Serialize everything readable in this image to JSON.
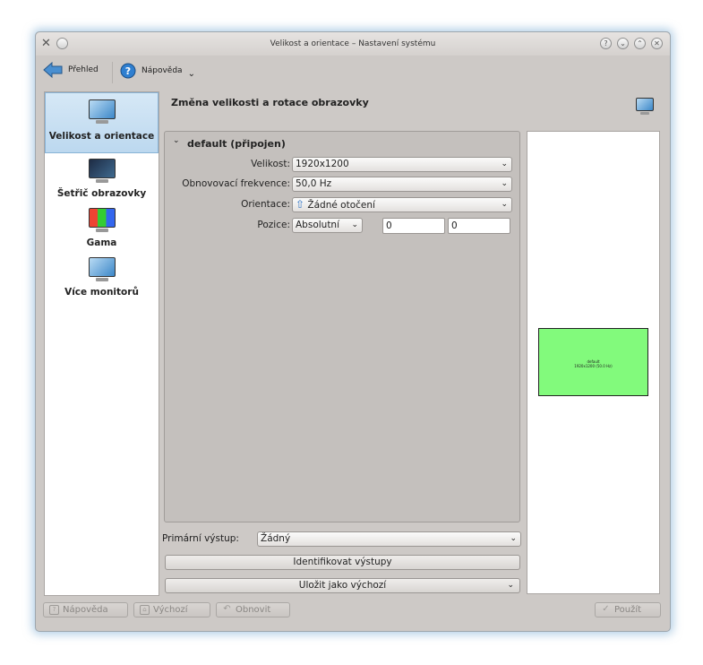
{
  "window": {
    "title": "Velikost a orientace – Nastavení systému"
  },
  "titlebar_buttons": [
    "?",
    "⌄",
    "⌃",
    "✕"
  ],
  "toolbar": {
    "overview_label": "Přehled",
    "help_label": "Nápověda",
    "help_menu_chevron": "⌄"
  },
  "sidebar": {
    "items": [
      {
        "label": "Velikost a orientace",
        "icon": "display-icon",
        "selected": true
      },
      {
        "label": "Šetřič obrazovky",
        "icon": "screensaver-icon",
        "selected": false
      },
      {
        "label": "Gama",
        "icon": "gamma-icon",
        "selected": false
      },
      {
        "label": "Více monitorů",
        "icon": "multi-monitor-icon",
        "selected": false
      }
    ]
  },
  "main": {
    "header_title": "Změna velikosti a rotace obrazovky",
    "output": {
      "name": "default (připojen)",
      "collapse_glyph": "⌄",
      "size_label": "Velikost:",
      "size_value": "1920x1200",
      "refresh_label": "Obnovovací frekvence:",
      "refresh_value": "50,0 Hz",
      "orientation_label": "Orientace:",
      "orientation_value": "Žádné otočení",
      "position_label": "Pozice:",
      "position_value": "Absolutní",
      "pos_x": "0",
      "pos_y": "0"
    },
    "primary_output_label": "Primární výstup:",
    "primary_output_value": "Žádný",
    "identify_button": "Identifikovat výstupy",
    "save_default_button": "Uložit jako výchozí"
  },
  "preview": {
    "output_name": "default",
    "output_info": "1920x1200 (50.0 Hz)",
    "color": "#82fa7c"
  },
  "bottom_buttons": {
    "help": "Nápověda",
    "defaults": "Výchozí",
    "reset": "Obnovit",
    "apply": "Použít"
  },
  "colors": {
    "selection": "#bcd8ef",
    "window_bg": "#cdc9c6"
  }
}
